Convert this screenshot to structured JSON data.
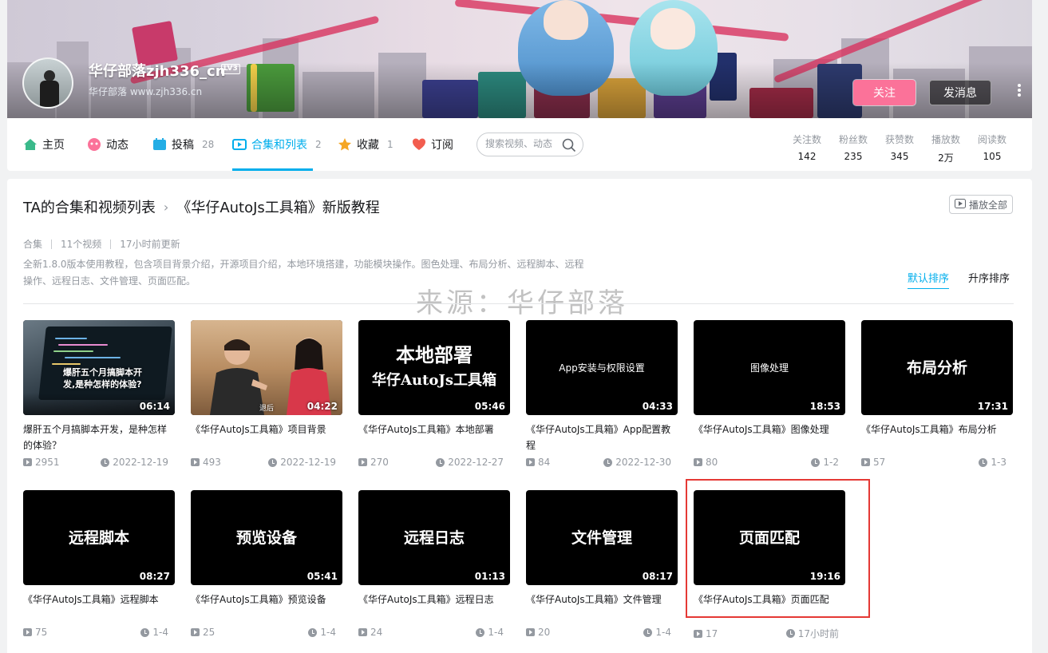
{
  "profile": {
    "username": "华仔部落zjh336_cn",
    "level": "LV3",
    "sign": "华仔部落 www.zjh336.cn",
    "follow_label": "关注",
    "message_label": "发消息",
    "more_label": "⋮"
  },
  "nav": {
    "items": [
      {
        "label": "主页",
        "count": ""
      },
      {
        "label": "动态",
        "count": ""
      },
      {
        "label": "投稿",
        "count": "28"
      },
      {
        "label": "合集和列表",
        "count": "2"
      },
      {
        "label": "收藏",
        "count": "1"
      },
      {
        "label": "订阅",
        "count": ""
      }
    ],
    "search_placeholder": "搜索视频、动态"
  },
  "stats": [
    {
      "label": "关注数",
      "value": "142"
    },
    {
      "label": "粉丝数",
      "value": "235"
    },
    {
      "label": "获赞数",
      "value": "345"
    },
    {
      "label": "播放数",
      "value": "2万"
    },
    {
      "label": "阅读数",
      "value": "105"
    }
  ],
  "collection": {
    "crumb_parent": "TA的合集和视频列表",
    "crumb_sep": "›",
    "title": "《华仔AutoJs工具箱》新版教程",
    "play_all_label": "播放全部",
    "type": "合集",
    "count": "11个视频",
    "updated": "17小时前更新",
    "description": "全新1.8.0版本使用教程，包含项目背景介绍，开源项目介绍，本地环境搭建，功能模块操作。图色处理、布局分析、远程脚本、远程操作、远程日志、文件管理、页面匹配。",
    "sort_default": "默认排序",
    "sort_asc": "升序排序",
    "watermark": "来源：华仔部落"
  },
  "videos": [
    {
      "cover": "爆肝五个月搞脚本开发,是种怎样的体验?",
      "duration": "06:14",
      "title": "爆肝五个月搞脚本开发，是种怎样的体验？",
      "plays": "2951",
      "date": "2022-12-19"
    },
    {
      "cover": "退后",
      "duration": "04:22",
      "title": "《华仔AutoJs工具箱》项目背景",
      "plays": "493",
      "date": "2022-12-19"
    },
    {
      "cover": "本地部署",
      "cover2": "华仔AutoJs工具箱",
      "duration": "05:46",
      "title": "《华仔AutoJs工具箱》本地部署",
      "plays": "270",
      "date": "2022-12-27"
    },
    {
      "cover": "App安装与权限设置",
      "duration": "04:33",
      "title": "《华仔AutoJs工具箱》App配置教程",
      "plays": "84",
      "date": "2022-12-30"
    },
    {
      "cover": "图像处理",
      "duration": "18:53",
      "title": "《华仔AutoJs工具箱》图像处理",
      "plays": "80",
      "date": "1-2"
    },
    {
      "cover": "布局分析",
      "duration": "17:31",
      "title": "《华仔AutoJs工具箱》布局分析",
      "plays": "57",
      "date": "1-3"
    },
    {
      "cover": "远程脚本",
      "duration": "08:27",
      "title": "《华仔AutoJs工具箱》远程脚本",
      "plays": "75",
      "date": "1-4"
    },
    {
      "cover": "预览设备",
      "duration": "05:41",
      "title": "《华仔AutoJs工具箱》预览设备",
      "plays": "25",
      "date": "1-4"
    },
    {
      "cover": "远程日志",
      "duration": "01:13",
      "title": "《华仔AutoJs工具箱》远程日志",
      "plays": "24",
      "date": "1-4"
    },
    {
      "cover": "文件管理",
      "duration": "08:17",
      "title": "《华仔AutoJs工具箱》文件管理",
      "plays": "20",
      "date": "1-4"
    },
    {
      "cover": "页面匹配",
      "duration": "19:16",
      "title": "《华仔AutoJs工具箱》页面匹配",
      "plays": "17",
      "date": "17小时前"
    }
  ],
  "colors": {
    "accent": "#00aeec",
    "follow": "#fb7299",
    "highlight_box": "#e53935"
  }
}
